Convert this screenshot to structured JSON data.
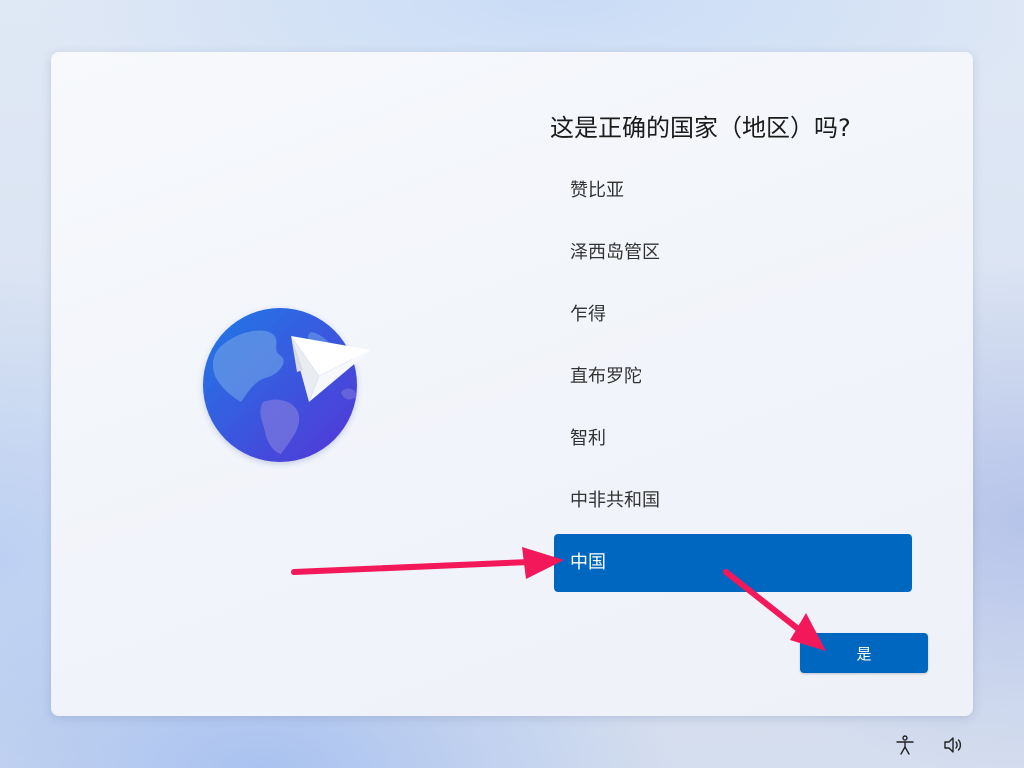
{
  "dialog": {
    "title": "这是正确的国家（地区）吗?",
    "countries": [
      {
        "label": "赞比亚",
        "selected": false
      },
      {
        "label": "泽西岛管区",
        "selected": false
      },
      {
        "label": "乍得",
        "selected": false
      },
      {
        "label": "直布罗陀",
        "selected": false
      },
      {
        "label": "智利",
        "selected": false
      },
      {
        "label": "中非共和国",
        "selected": false
      },
      {
        "label": "中国",
        "selected": true
      }
    ],
    "yes_button": "是"
  },
  "taskbar": {
    "icons": [
      "accessibility-icon",
      "volume-icon"
    ]
  },
  "colors": {
    "accent": "#0067c0",
    "annotation_arrow": "#f2185a"
  }
}
